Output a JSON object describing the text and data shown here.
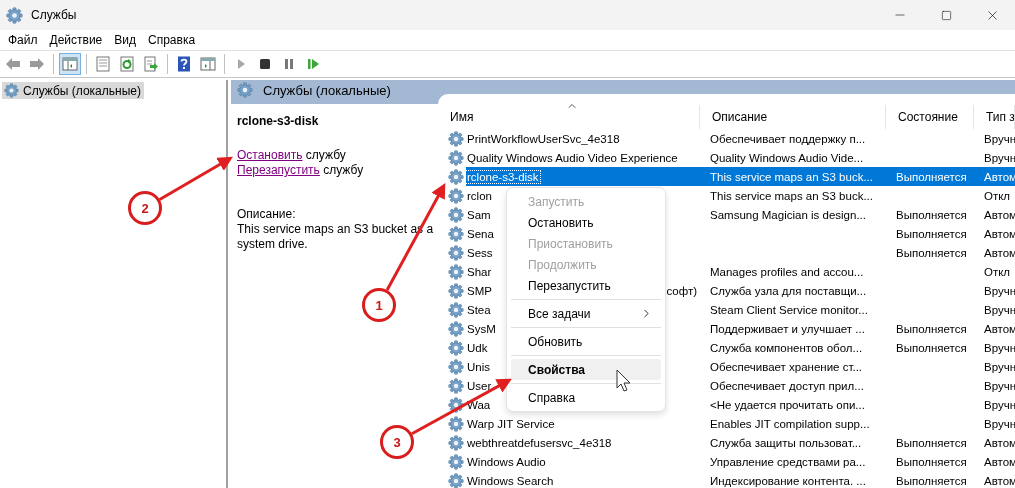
{
  "window": {
    "title": "Службы"
  },
  "menu": [
    "Файл",
    "Действие",
    "Вид",
    "Справка"
  ],
  "toolbar": [
    {
      "kind": "back",
      "pressed": false
    },
    {
      "kind": "forward",
      "pressed": false
    },
    {
      "kind": "separator"
    },
    {
      "kind": "console-tree",
      "pressed": true
    },
    {
      "kind": "separator"
    },
    {
      "kind": "properties",
      "pressed": false
    },
    {
      "kind": "refresh",
      "pressed": false
    },
    {
      "kind": "export",
      "pressed": false
    },
    {
      "kind": "separator"
    },
    {
      "kind": "help",
      "pressed": false
    },
    {
      "kind": "action-pane",
      "pressed": false
    },
    {
      "kind": "separator"
    },
    {
      "kind": "start",
      "pressed": false
    },
    {
      "kind": "stop",
      "pressed": false
    },
    {
      "kind": "pause",
      "pressed": false
    },
    {
      "kind": "restart",
      "pressed": false
    }
  ],
  "tree": {
    "items": [
      {
        "label": "Службы (локальные)",
        "selected": true
      }
    ]
  },
  "panel": {
    "title": "Службы (локальные)"
  },
  "details": {
    "name": "rclone-s3-disk",
    "actions": [
      {
        "link": "Остановить",
        "text": "службу"
      },
      {
        "link": "Перезапустить",
        "text": "службу"
      }
    ],
    "description_label": "Описание:",
    "description": "This service maps an S3 bucket as a system drive."
  },
  "table": {
    "columns": [
      {
        "label": "Имя",
        "sorted": true
      },
      {
        "label": "Описание",
        "sorted": false
      },
      {
        "label": "Состояние",
        "sorted": false
      },
      {
        "label": "Тип з",
        "sorted": false
      }
    ],
    "rows": [
      {
        "name": "PrintWorkflowUserSvc_4e318",
        "description": "Обеспечивает поддержку п...",
        "startup": "Вручн",
        "selected": false
      },
      {
        "name": "Quality Windows Audio Video Experience",
        "description": "Quality Windows Audio Vide...",
        "startup": "Вручн",
        "selected": false
      },
      {
        "name": "rclone-s3-disk",
        "description": "This service maps an S3 buck...",
        "status": "Выполняется",
        "startup": "Автом",
        "selected": true
      },
      {
        "name": "rclon",
        "description": "This service maps an S3 buck...",
        "startup": "Откл",
        "selected": false
      },
      {
        "name": "Sam",
        "description": "Samsung Magician is design...",
        "status": "Выполняется",
        "startup": "Автом",
        "selected": false
      },
      {
        "name": "Sena",
        "status": "Выполняется",
        "startup": "Автом",
        "selected": false
      },
      {
        "name": "Sess",
        "status": "Выполняется",
        "startup": "Автом",
        "selected": false
      },
      {
        "name": "Shar",
        "description": "Manages profiles and accou...",
        "startup": "Откл",
        "selected": false
      },
      {
        "name": "SMP",
        "name_tail": "софт)",
        "description": "Служба узла для поставщи...",
        "startup": "Вручн",
        "selected": false
      },
      {
        "name": "Stea",
        "description": "Steam Client Service monitor...",
        "startup": "Вручн",
        "selected": false
      },
      {
        "name": "SysM",
        "description": "Поддерживает и улучшает ...",
        "status": "Выполняется",
        "startup": "Автом",
        "selected": false
      },
      {
        "name": "Udk",
        "description": "Служба компонентов обол...",
        "status": "Выполняется",
        "startup": "Вручн",
        "selected": false
      },
      {
        "name": "Unis",
        "description": "Обеспечивает хранение ст...",
        "startup": "Вручн",
        "selected": false
      },
      {
        "name": "User",
        "description": "Обеспечивает доступ прил...",
        "startup": "Вручн",
        "selected": false
      },
      {
        "name": "Waa",
        "description": "<Не удается прочитать опи...",
        "startup": "Вручн",
        "selected": false
      },
      {
        "name": "Warp JIT Service",
        "description": "Enables JIT compilation supp...",
        "startup": "Вручн",
        "selected": false
      },
      {
        "name": "webthreatdefusersvc_4e318",
        "description": "Служба защиты пользоват...",
        "status": "Выполняется",
        "startup": "Автом",
        "selected": false
      },
      {
        "name": "Windows Audio",
        "description": "Управление средствами ра...",
        "status": "Выполняется",
        "startup": "Автом",
        "selected": false
      },
      {
        "name": "Windows Search",
        "description": "Индексирование контента. ...",
        "status": "Выполняется",
        "startup": "Автом",
        "selected": false
      }
    ]
  },
  "context_menu": {
    "items": [
      {
        "kind": "item",
        "label": "Запустить",
        "disabled": true,
        "selected": false,
        "default": false
      },
      {
        "kind": "item",
        "label": "Остановить",
        "disabled": false,
        "selected": false,
        "default": false
      },
      {
        "kind": "item",
        "label": "Приостановить",
        "disabled": true,
        "selected": false,
        "default": false
      },
      {
        "kind": "item",
        "label": "Продолжить",
        "disabled": true,
        "selected": false,
        "default": false
      },
      {
        "kind": "item",
        "label": "Перезапустить",
        "disabled": false,
        "selected": false,
        "default": false
      },
      {
        "kind": "separator"
      },
      {
        "kind": "submenu",
        "label": "Все задачи",
        "disabled": false,
        "selected": false,
        "default": false
      },
      {
        "kind": "separator"
      },
      {
        "kind": "item",
        "label": "Обновить",
        "disabled": false,
        "selected": false,
        "default": false
      },
      {
        "kind": "separator"
      },
      {
        "kind": "item",
        "label": "Свойства",
        "disabled": false,
        "selected": true,
        "default": true
      },
      {
        "kind": "separator"
      },
      {
        "kind": "item",
        "label": "Справка",
        "disabled": false,
        "selected": false,
        "default": false
      }
    ]
  },
  "annotations": [
    {
      "label": "1"
    },
    {
      "label": "2"
    },
    {
      "label": "3"
    }
  ]
}
